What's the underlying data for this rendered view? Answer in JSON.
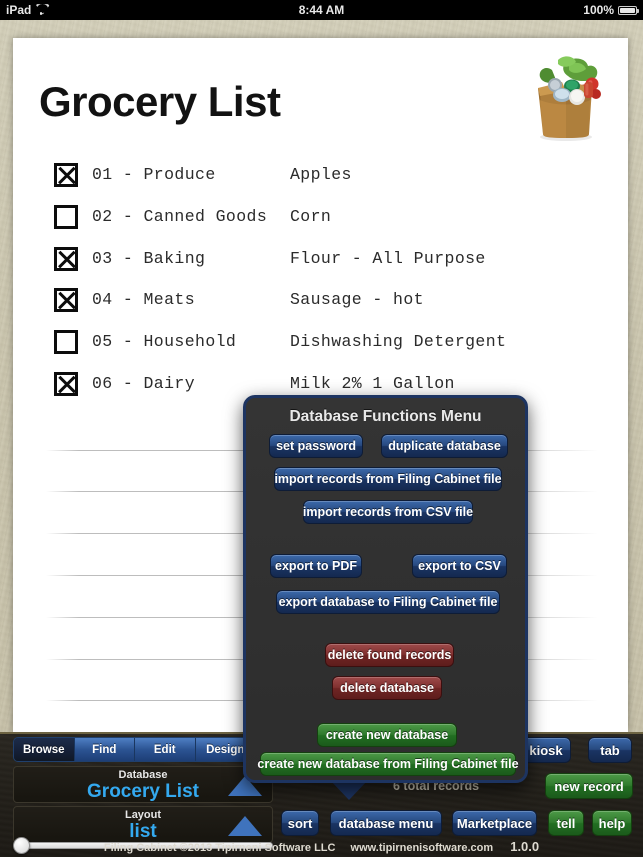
{
  "status_bar": {
    "device": "iPad",
    "wifi_icon": "wifi-icon",
    "time": "8:44 AM",
    "battery_percent": "100%",
    "battery_icon": "battery-icon"
  },
  "record": {
    "title": "Grocery List",
    "image_icon": "grocery-bag-image",
    "rows": [
      {
        "checked": true,
        "category": "01 - Produce",
        "item": "Apples"
      },
      {
        "checked": false,
        "category": "02 - Canned Goods",
        "item": "Corn"
      },
      {
        "checked": true,
        "category": "03 - Baking",
        "item": "Flour - All Purpose"
      },
      {
        "checked": true,
        "category": "04 - Meats",
        "item": "Sausage - hot"
      },
      {
        "checked": false,
        "category": "05 - Household",
        "item": "Dishwashing Detergent"
      },
      {
        "checked": true,
        "category": "06 - Dairy",
        "item": "Milk 2% 1 Gallon"
      }
    ],
    "empty_row_count": 8
  },
  "toolbar": {
    "modes": [
      {
        "label": "Browse",
        "active": true
      },
      {
        "label": "Find",
        "active": false
      },
      {
        "label": "Edit",
        "active": false
      },
      {
        "label": "Design",
        "active": false
      }
    ],
    "database_label": "Database",
    "database_value": "Grocery List",
    "layout_label": "Layout",
    "layout_value": "list",
    "records_count": "6 total records",
    "buttons": [
      {
        "name": "sort-button",
        "label": "sort",
        "color": "blue"
      },
      {
        "name": "database-menu-button",
        "label": "database menu",
        "color": "blue"
      },
      {
        "name": "marketplace-button",
        "label": "Marketplace",
        "color": "blue"
      },
      {
        "name": "tell-button",
        "label": "tell",
        "color": "green"
      },
      {
        "name": "help-button",
        "label": "help",
        "color": "green"
      },
      {
        "name": "kiosk-button",
        "label": "kiosk",
        "color": "blue"
      },
      {
        "name": "tab-button",
        "label": "tab",
        "color": "blue"
      },
      {
        "name": "new-record-button",
        "label": "new record",
        "color": "green"
      }
    ]
  },
  "modal": {
    "title": "Database Functions Menu",
    "buttons": [
      {
        "name": "set-password-button",
        "label": "set password",
        "color": "blue"
      },
      {
        "name": "duplicate-database-button",
        "label": "duplicate database",
        "color": "blue"
      },
      {
        "name": "import-records-filing-cabinet-button",
        "label": "import records from Filing Cabinet file",
        "color": "blue"
      },
      {
        "name": "import-records-csv-button",
        "label": "import records from CSV file",
        "color": "blue"
      },
      {
        "name": "export-to-pdf-button",
        "label": "export to PDF",
        "color": "blue"
      },
      {
        "name": "export-to-csv-button",
        "label": "export to CSV",
        "color": "blue"
      },
      {
        "name": "export-database-filing-cabinet-button",
        "label": "export database to Filing Cabinet file",
        "color": "blue"
      },
      {
        "name": "delete-found-records-button",
        "label": "delete found records",
        "color": "red"
      },
      {
        "name": "delete-database-button",
        "label": "delete database",
        "color": "red"
      },
      {
        "name": "create-new-database-button",
        "label": "create new database",
        "color": "green"
      },
      {
        "name": "create-new-database-filing-cabinet-button",
        "label": "create new database from Filing Cabinet file",
        "color": "green"
      }
    ]
  },
  "footer": {
    "copyright": "Filing Cabinet ©2013 Tipirneni Software LLC",
    "url": "www.tipirnenisoftware.com",
    "version": "1.0.0"
  },
  "colors": {
    "accent_blue": "#34a9ef",
    "button_blue": "#27497f",
    "button_green": "#2f7a2d",
    "button_red": "#80302f",
    "modal_bg": "#2d2d2d",
    "modal_border": "#1d3461"
  }
}
